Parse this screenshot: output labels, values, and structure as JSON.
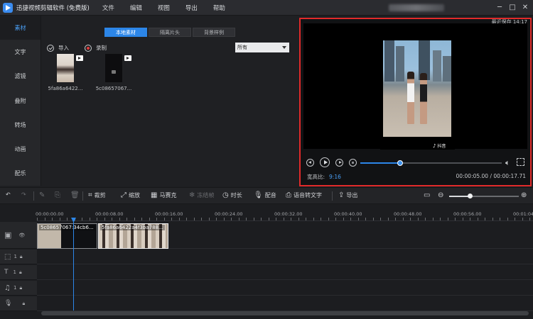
{
  "app": {
    "title": "迅捷视频剪辑软件 (免费版)",
    "menu": [
      "文件",
      "编辑",
      "视图",
      "导出",
      "帮助"
    ]
  },
  "window_controls": [
    "─",
    "□",
    "✕"
  ],
  "sidebar": {
    "items": [
      {
        "label": "素材",
        "active": true
      },
      {
        "label": "文字",
        "active": false
      },
      {
        "label": "滤镜",
        "active": false
      },
      {
        "label": "叠附",
        "active": false
      },
      {
        "label": "转场",
        "active": false
      },
      {
        "label": "动画",
        "active": false
      },
      {
        "label": "配乐",
        "active": false
      }
    ]
  },
  "library": {
    "tabs": [
      {
        "label": "本地素材",
        "active": true
      },
      {
        "label": "隔离片头",
        "active": false
      },
      {
        "label": "背景样例",
        "active": false
      }
    ],
    "import_label": "导入",
    "record_label": "录制",
    "filter_value": "所有",
    "items": [
      {
        "name": "5fa86a6422...",
        "icon": "video-badge-icon"
      },
      {
        "name": "5c08657067...",
        "icon": "video-badge-icon"
      }
    ]
  },
  "preview": {
    "save_status": "最近保存 14:17",
    "watermark_brand": "抖音",
    "watermark_id": "抖音号: 40trick 🎵",
    "aspect_label": "宽高比:",
    "aspect_value": "9:16",
    "time_current": "00:00:05.00",
    "time_separator": " / ",
    "time_total": "00:00:17.71",
    "progress_fraction": 0.28
  },
  "toolbar": {
    "undo_icon": "↶",
    "redo_icon": "↷",
    "crop_label": "裁剪",
    "zoom_label": "缩放",
    "mosaic_label": "马赛克",
    "freeze_label": "冻结帧",
    "duration_label": "时长",
    "voiceover_label": "配音",
    "speech_to_text_label": "语音转文字",
    "export_label": "导出",
    "zoom_fraction": 0.3
  },
  "timeline": {
    "ruler": [
      "00:00:00.00",
      "00:00:08.00",
      "00:00:16.00",
      "00:00:24.00",
      "00:00:32.00",
      "00:00:40.00",
      "00:00:48.00",
      "00:00:56.00",
      "00:01:04"
    ],
    "clips": [
      {
        "label": "5c08657067:34cb6..."
      },
      {
        "label": "5fa86a6422a4f3ba788..."
      }
    ],
    "track_counts": [
      "1",
      "1",
      "1"
    ]
  }
}
